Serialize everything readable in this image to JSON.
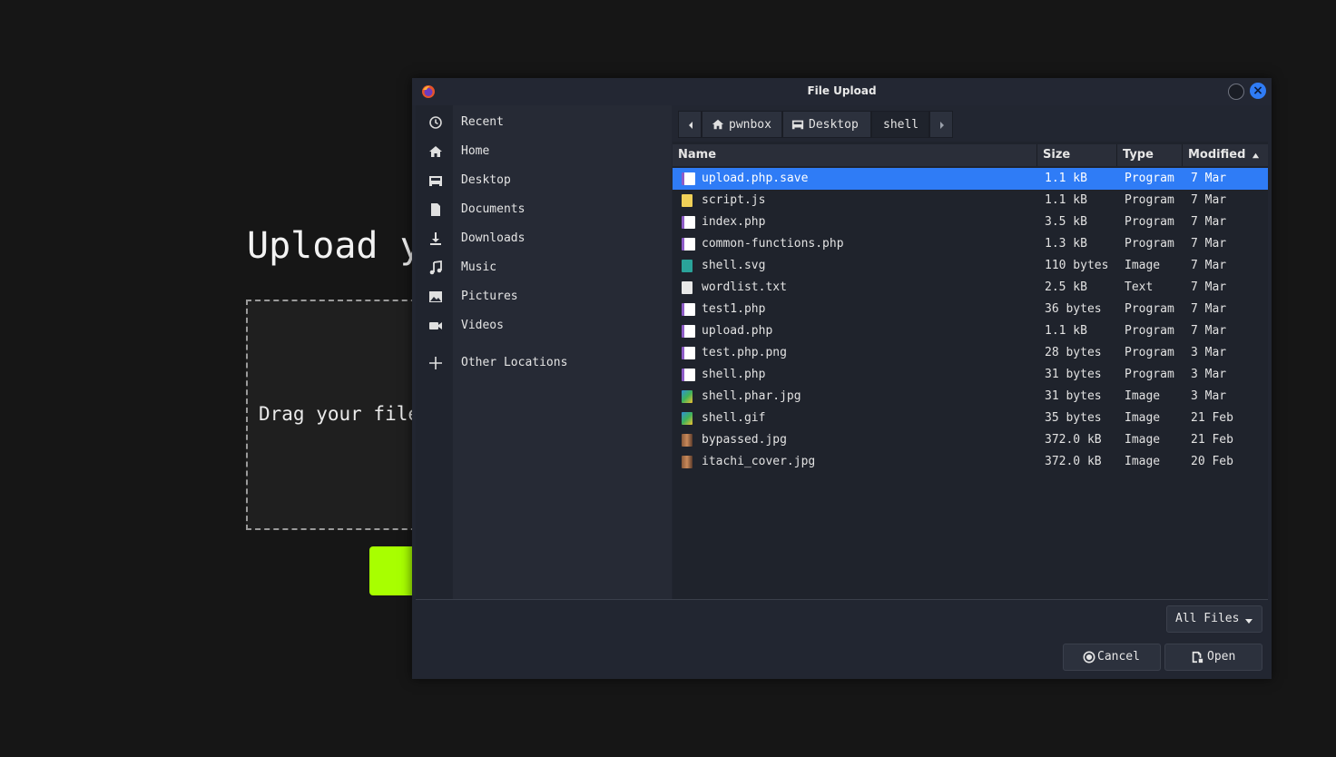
{
  "background_page": {
    "title": "Upload y",
    "drop_text": "Drag your file"
  },
  "dialog": {
    "title": "File Upload",
    "app_icon": "firefox-icon",
    "sidebar": [
      {
        "label": "Recent",
        "icon": "clock-icon"
      },
      {
        "label": "Home",
        "icon": "home-icon"
      },
      {
        "label": "Desktop",
        "icon": "desktop-icon"
      },
      {
        "label": "Documents",
        "icon": "document-icon"
      },
      {
        "label": "Downloads",
        "icon": "download-icon"
      },
      {
        "label": "Music",
        "icon": "music-icon"
      },
      {
        "label": "Pictures",
        "icon": "picture-icon"
      },
      {
        "label": "Videos",
        "icon": "video-icon"
      },
      {
        "label": "Other Locations",
        "icon": "plus-icon"
      }
    ],
    "path": [
      "pwnbox",
      "Desktop",
      "shell"
    ],
    "columns": {
      "name": "Name",
      "size": "Size",
      "type": "Type",
      "modified": "Modified"
    },
    "sort": {
      "column": "modified",
      "direction": "ascending"
    },
    "files": [
      {
        "name": "upload.php.save",
        "size": "1.1 kB",
        "type": "Program",
        "modified": "7 Mar",
        "icon": "php-icon",
        "selected": true
      },
      {
        "name": "script.js",
        "size": "1.1 kB",
        "type": "Program",
        "modified": "7 Mar",
        "icon": "js-icon"
      },
      {
        "name": "index.php",
        "size": "3.5 kB",
        "type": "Program",
        "modified": "7 Mar",
        "icon": "php-icon"
      },
      {
        "name": "common-functions.php",
        "size": "1.3 kB",
        "type": "Program",
        "modified": "7 Mar",
        "icon": "php-icon"
      },
      {
        "name": "shell.svg",
        "size": "110 bytes",
        "type": "Image",
        "modified": "7 Mar",
        "icon": "svg-icon"
      },
      {
        "name": "wordlist.txt",
        "size": "2.5 kB",
        "type": "Text",
        "modified": "7 Mar",
        "icon": "text-file-icon"
      },
      {
        "name": "test1.php",
        "size": "36 bytes",
        "type": "Program",
        "modified": "7 Mar",
        "icon": "php-icon"
      },
      {
        "name": "upload.php",
        "size": "1.1 kB",
        "type": "Program",
        "modified": "7 Mar",
        "icon": "php-icon"
      },
      {
        "name": "test.php.png",
        "size": "28 bytes",
        "type": "Program",
        "modified": "3 Mar",
        "icon": "php-icon"
      },
      {
        "name": "shell.php",
        "size": "31 bytes",
        "type": "Program",
        "modified": "3 Mar",
        "icon": "php-icon"
      },
      {
        "name": "shell.phar.jpg",
        "size": "31 bytes",
        "type": "Image",
        "modified": "3 Mar",
        "icon": "image-icon"
      },
      {
        "name": "shell.gif",
        "size": "35 bytes",
        "type": "Image",
        "modified": "21 Feb",
        "icon": "image-icon"
      },
      {
        "name": "bypassed.jpg",
        "size": "372.0 kB",
        "type": "Image",
        "modified": "21 Feb",
        "icon": "photo-thumb-icon"
      },
      {
        "name": "itachi_cover.jpg",
        "size": "372.0 kB",
        "type": "Image",
        "modified": "20 Feb",
        "icon": "photo-thumb-icon"
      }
    ],
    "filter": "All Files",
    "cancel_label": "Cancel",
    "open_label": "Open",
    "colors": {
      "accent": "#2f7cf6",
      "background_button": "#a8ff00",
      "php": "#8e5cc8",
      "js": "#f0d058",
      "svg": "#2aa39a"
    }
  }
}
